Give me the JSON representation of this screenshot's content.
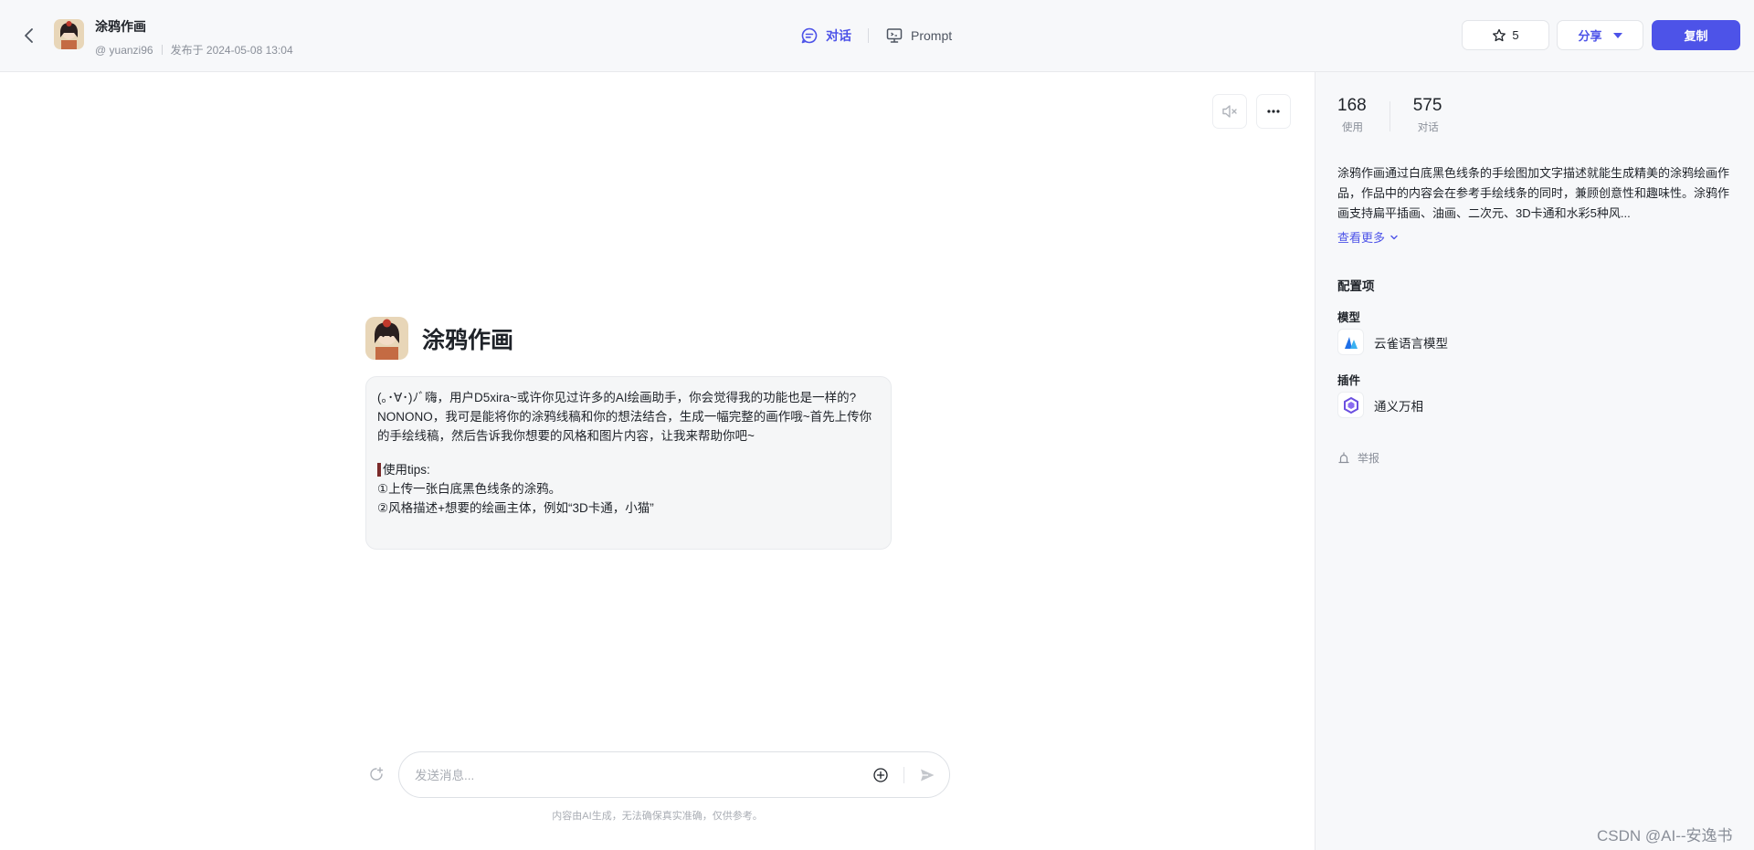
{
  "header": {
    "title": "涂鸦作画",
    "author": "@ yuanzi96",
    "published": "发布于 2024-05-08 13:04",
    "tabs": [
      {
        "label": "对话",
        "active": true,
        "icon": "chat-icon"
      },
      {
        "label": "Prompt",
        "active": false,
        "icon": "monitor-icon"
      }
    ],
    "star_count": "5",
    "share_label": "分享",
    "copy_label": "复制"
  },
  "intro": {
    "name": "涂鸦作画",
    "lines": [
      "(｡･∀･)ﾉﾞ嗨，用户D5xira~或许你见过许多的AI绘画助手，你会觉得我的功能也是一样的?",
      "NONONO，我可是能将你的涂鸦线稿和你的想法结合，生成一幅完整的画作哦~首先上传你的手绘线稿，然后告诉我你想要的风格和图片内容，让我来帮助你吧~"
    ],
    "tips_title": "使用tips:",
    "tips": [
      "①上传一张白底黑色线条的涂鸦。",
      "②风格描述+想要的绘画主体，例如“3D卡通，小猫”"
    ]
  },
  "composer": {
    "placeholder": "发送消息..."
  },
  "disclaimer": "内容由AI生成，无法确保真实准确，仅供参考。",
  "sidebar": {
    "stats": [
      {
        "value": "168",
        "label": "使用"
      },
      {
        "value": "575",
        "label": "对话"
      }
    ],
    "description": "涂鸦作画通过白底黑色线条的手绘图加文字描述就能生成精美的涂鸦绘画作品，作品中的内容会在参考手绘线条的同时，兼顾创意性和趣味性。涂鸦作画支持扁平插画、油画、二次元、3D卡通和水彩5种风...",
    "more_label": "查看更多",
    "config_title": "配置项",
    "model_title": "模型",
    "model_name": "云雀语言模型",
    "plugin_title": "插件",
    "plugin_name": "通义万相",
    "report_label": "举报"
  },
  "watermark": "CSDN @AI--安逸书",
  "colors": {
    "accent": "#4d53e8",
    "sidebar_bg": "#f7f8fa"
  }
}
